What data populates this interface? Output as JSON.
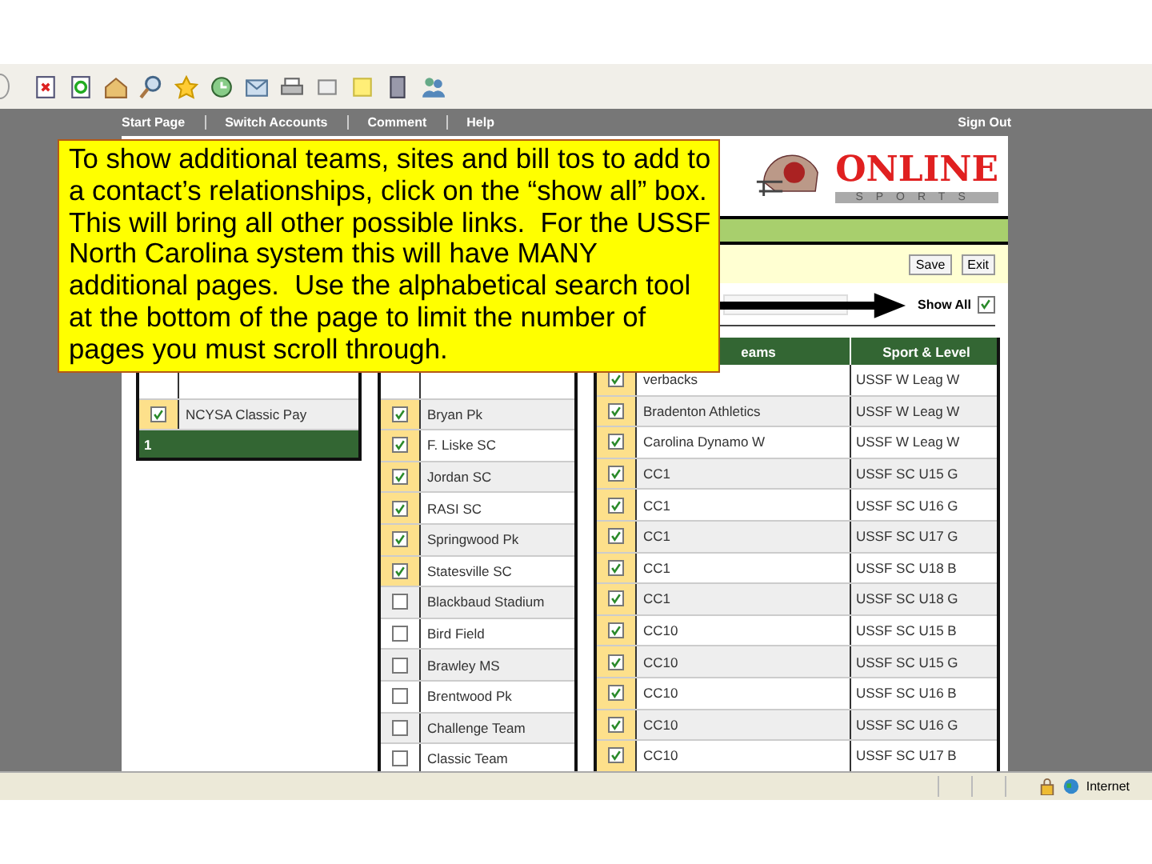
{
  "nav": {
    "links": [
      "Start Page",
      "Switch Accounts",
      "Comment",
      "Help"
    ],
    "sign_out": "Sign Out"
  },
  "logo": {
    "title": "ONLINE",
    "subtitle": "SPORTS"
  },
  "buttons": [
    "Save",
    "Exit"
  ],
  "show_all": {
    "label": "Show All",
    "checked": true
  },
  "left_table": {
    "rows": [
      {
        "name": "NCYSA Classic Pay",
        "checked": true
      }
    ],
    "footer": "1"
  },
  "sites_table": {
    "rows": [
      {
        "name": "Bryan Pk",
        "checked": true
      },
      {
        "name": "F. Liske SC",
        "checked": true
      },
      {
        "name": "Jordan SC",
        "checked": true
      },
      {
        "name": "RASI SC",
        "checked": true
      },
      {
        "name": "Springwood Pk",
        "checked": true
      },
      {
        "name": "Statesville SC",
        "checked": true
      },
      {
        "name": "Blackbaud Stadium",
        "checked": false
      },
      {
        "name": "Bird Field",
        "checked": false
      },
      {
        "name": "Brawley MS",
        "checked": false
      },
      {
        "name": "Brentwood Pk",
        "checked": false
      },
      {
        "name": "Challenge Team",
        "checked": false
      },
      {
        "name": "Classic Team",
        "checked": false
      }
    ]
  },
  "teams_table": {
    "columns": [
      "eams",
      "Sport & Level"
    ],
    "rows": [
      {
        "team": "verbacks",
        "level": "USSF W Leag W",
        "checked": true
      },
      {
        "team": "Bradenton Athletics",
        "level": "USSF W Leag W",
        "checked": true
      },
      {
        "team": "Carolina Dynamo W",
        "level": "USSF W Leag W",
        "checked": true
      },
      {
        "team": "CC1",
        "level": "USSF SC U15 G",
        "checked": true
      },
      {
        "team": "CC1",
        "level": "USSF SC U16 G",
        "checked": true
      },
      {
        "team": "CC1",
        "level": "USSF SC U17 G",
        "checked": true
      },
      {
        "team": "CC1",
        "level": "USSF SC U18 B",
        "checked": true
      },
      {
        "team": "CC1",
        "level": "USSF SC U18 G",
        "checked": true
      },
      {
        "team": "CC10",
        "level": "USSF SC U15 B",
        "checked": true
      },
      {
        "team": "CC10",
        "level": "USSF SC U15 G",
        "checked": true
      },
      {
        "team": "CC10",
        "level": "USSF SC U16 B",
        "checked": true
      },
      {
        "team": "CC10",
        "level": "USSF SC U16 G",
        "checked": true
      },
      {
        "team": "CC10",
        "level": "USSF SC U17 B",
        "checked": true
      }
    ]
  },
  "status_bar": {
    "zone": "Internet"
  },
  "callout": {
    "text": "To show additional teams, sites and bill tos to add to a contact’s relationships, click on the “show all” box.  This will bring all other possible links.  For the USSF North Carolina system this will have MANY additional pages.  Use the alphabetical search tool at the bottom of the page to limit the number of pages you must scroll through."
  }
}
